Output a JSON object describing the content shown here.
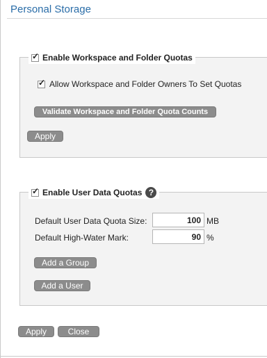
{
  "page": {
    "title": "Personal Storage"
  },
  "workspace_quotas": {
    "enable_label": "Enable Workspace and Folder Quotas",
    "enable_checked": true,
    "allow_owners_label": "Allow Workspace and Folder Owners To Set Quotas",
    "allow_owners_checked": true,
    "validate_button": "Validate Workspace and Folder Quota Counts",
    "apply_button": "Apply"
  },
  "user_quotas": {
    "enable_label": "Enable User Data Quotas",
    "enable_checked": true,
    "help_icon": "question-mark-icon",
    "default_size_label": "Default User Data Quota Size:",
    "default_size_value": "100",
    "default_size_unit": "MB",
    "high_water_label": "Default High-Water Mark:",
    "high_water_value": "90",
    "high_water_unit": "%",
    "add_group_button": "Add a Group",
    "add_user_button": "Add a User"
  },
  "footer": {
    "apply_button": "Apply",
    "close_button": "Close"
  }
}
